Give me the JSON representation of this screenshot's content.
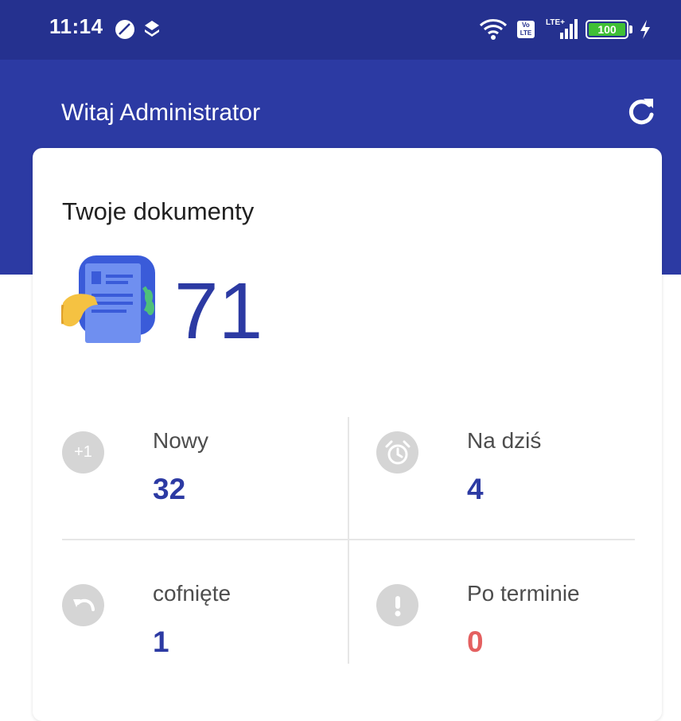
{
  "status_bar": {
    "time": "11:14",
    "volte": "Vo LTE",
    "network": "LTE+",
    "battery": "100",
    "icons": [
      "app-circle-icon",
      "layers-icon",
      "wifi-icon",
      "volte-icon",
      "signal-icon",
      "battery-icon",
      "charging-icon"
    ]
  },
  "header": {
    "title": "Witaj Administrator",
    "refresh_icon": "refresh-icon"
  },
  "documents": {
    "title": "Twoje dokumenty",
    "total": "71",
    "illustration_icon": "document-hand-illustration",
    "stats": [
      {
        "label": "Nowy",
        "value": "32",
        "icon": "plus-one-icon",
        "icon_text": "+1"
      },
      {
        "label": "Na dziś",
        "value": "4",
        "icon": "alarm-clock-icon"
      },
      {
        "label": "cofnięte",
        "value": "1",
        "icon": "undo-icon"
      },
      {
        "label": "Po terminie",
        "value": "0",
        "icon": "exclamation-icon"
      }
    ]
  },
  "colors": {
    "status_bar": "#25318f",
    "header": "#2c3aa3",
    "accent": "#2c3aa3",
    "overdue": "#e46060",
    "icon_gray": "#d5d5d5"
  }
}
